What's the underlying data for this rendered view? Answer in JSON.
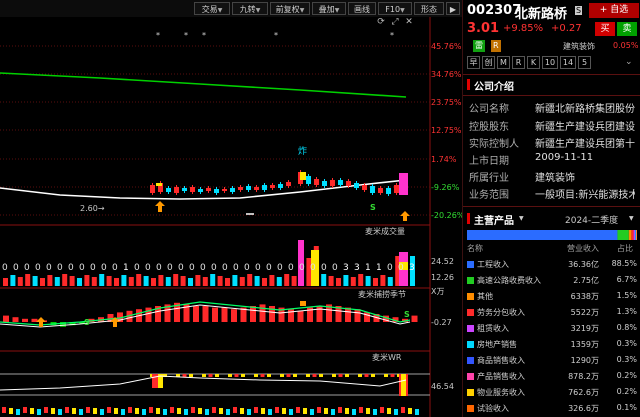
{
  "toolbar": {
    "buttons": [
      "交易",
      "九转",
      "前复权",
      "叠加",
      "画线",
      "F10",
      "形态"
    ]
  },
  "chart": {
    "stars": [
      "*",
      "*",
      "*",
      "*",
      "*"
    ],
    "main_axis": [
      "45.76%",
      "34.76%",
      "23.75%",
      "12.75%",
      "1.74%",
      "-9.26%",
      "-20.26%"
    ],
    "low_marker": "2.60→",
    "high_marker": "炸",
    "volume_panel": {
      "title": "麦米成交量",
      "axis": [
        "24.52",
        "12.26"
      ],
      "unit": "X万",
      "values": [
        0,
        0,
        0,
        0,
        0,
        0,
        0,
        0,
        0,
        0,
        0,
        1,
        0,
        0,
        0,
        0,
        0,
        0,
        0,
        0,
        0,
        0,
        0,
        0,
        0,
        0,
        0,
        0,
        0,
        0,
        0,
        3,
        3,
        1,
        1,
        0,
        0,
        3
      ]
    },
    "money_panel": {
      "title": "麦米捕捞季节",
      "axis": [
        "-0.27"
      ]
    },
    "wr_panel": {
      "title": "麦米WR",
      "axis": [
        "46.54"
      ]
    },
    "s_marks": [
      "S",
      "S",
      "S"
    ],
    "colors": {
      "up": "#ff2a2a",
      "down": "#00e0ff",
      "yellow": "#ffe600",
      "green_line": "#00d000",
      "white_line": "#ffffff",
      "magenta": "#ff33cc",
      "text_red": "#ff3333",
      "text_green": "#33dd33"
    }
  },
  "stock": {
    "code": "002307",
    "name": "北新路桥",
    "tag": "S",
    "add_btn": "+ 自选",
    "price": "3.01",
    "change_pct": "+9.85%",
    "change": "+0.27",
    "buy": "买",
    "sell": "卖",
    "badges": [
      "雷",
      "R"
    ],
    "sector": "建筑装饰",
    "sector_pct": "0.05%",
    "periods": [
      "早",
      "创",
      "M",
      "R",
      "K",
      "10",
      "14",
      "5"
    ]
  },
  "company": {
    "section_title": "公司介绍",
    "fields": [
      {
        "label": "公司名称",
        "value": "新疆北新路桥集团股份..."
      },
      {
        "label": "控股股东",
        "value": "新疆生产建设兵团建设..."
      },
      {
        "label": "实际控制人",
        "value": "新疆生产建设兵团第十..."
      },
      {
        "label": "上市日期",
        "value": "2009-11-11"
      },
      {
        "label": "所属行业",
        "value": "建筑装饰"
      },
      {
        "label": "业务范围",
        "value": "一般项目:新兴能源技术..."
      }
    ]
  },
  "products": {
    "section_title": "主营产品",
    "period": "2024-二季度",
    "headers": [
      "名称",
      "营业收入",
      "占比"
    ],
    "rows": [
      {
        "name": "工程收入",
        "value": "36.36亿",
        "pct": "88.5%",
        "color": "#2b6cff"
      },
      {
        "name": "高速公路收费收入",
        "value": "2.75亿",
        "pct": "6.7%",
        "color": "#22cc22"
      },
      {
        "name": "其他",
        "value": "6338万",
        "pct": "1.5%",
        "color": "#ff8c00"
      },
      {
        "name": "劳务分包收入",
        "value": "5522万",
        "pct": "1.3%",
        "color": "#ff2a2a"
      },
      {
        "name": "租赁收入",
        "value": "3219万",
        "pct": "0.8%",
        "color": "#cc44ff"
      },
      {
        "name": "房地产销售",
        "value": "1359万",
        "pct": "0.3%",
        "color": "#00d8ff"
      },
      {
        "name": "商品销售收入",
        "value": "1290万",
        "pct": "0.3%",
        "color": "#3355ff"
      },
      {
        "name": "产品销售收入",
        "value": "878.2万",
        "pct": "0.2%",
        "color": "#ff44aa"
      },
      {
        "name": "物业服务收入",
        "value": "762.6万",
        "pct": "0.2%",
        "color": "#ffd000"
      },
      {
        "name": "试验收入",
        "value": "326.6万",
        "pct": "0.1%",
        "color": "#ff6600"
      }
    ]
  }
}
